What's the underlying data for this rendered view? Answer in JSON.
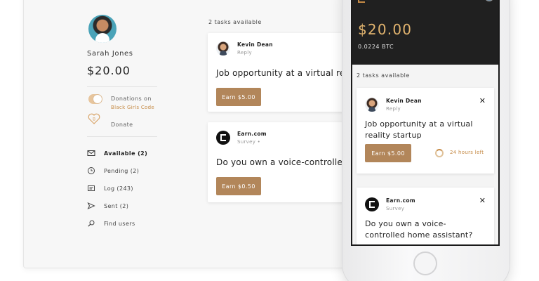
{
  "desktop": {
    "user": {
      "name": "Sarah Jones",
      "balance": "$20.00"
    },
    "donations": {
      "label": "Donations on",
      "org": "Black Girls Code",
      "enabled": true
    },
    "donate_label": "Donate",
    "nav": [
      {
        "label": "Available (2)",
        "icon": "envelope-icon",
        "active": true
      },
      {
        "label": "Pending (2)",
        "icon": "clock-icon",
        "active": false
      },
      {
        "label": "Log (243)",
        "icon": "log-icon",
        "active": false
      },
      {
        "label": "Sent (2)",
        "icon": "send-icon",
        "active": false
      },
      {
        "label": "Find users",
        "icon": "search-icon",
        "active": false
      }
    ],
    "tasks_available": "2 tasks available",
    "tasks": [
      {
        "sender": "Kevin Dean",
        "type": "Reply",
        "title": "Job opportunity at a virtual reality startup",
        "button": "Earn $5.00"
      },
      {
        "sender": "Earn.com",
        "type": "Survey •",
        "title": "Do you own a voice-controlled home assistant?",
        "button": "Earn $0.50"
      }
    ]
  },
  "mobile": {
    "balance": "$20.00",
    "btc": "0.0224 BTC",
    "tasks_available": "2 tasks available",
    "tasks": [
      {
        "sender": "Kevin Dean",
        "type": "Reply",
        "title": "Job opportunity at a virtual reality startup",
        "button": "Earn $5.00",
        "time_left": "24 hours left"
      },
      {
        "sender": "Earn.com",
        "type": "Survey",
        "title": "Do you own a voice-controlled home assistant?"
      }
    ]
  },
  "colors": {
    "accent": "#b2865a",
    "gold": "#e3b56f",
    "orange_text": "#c58a45",
    "dark_header": "#202020"
  }
}
